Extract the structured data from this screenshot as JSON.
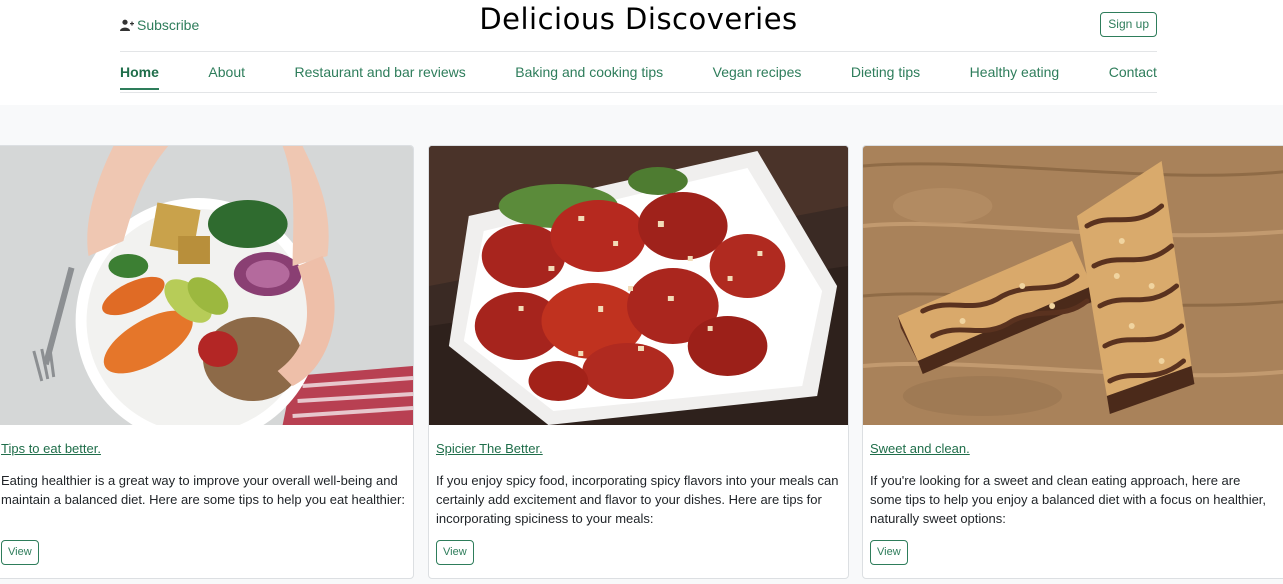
{
  "header": {
    "subscribe_label": "Subscribe",
    "brand": "Delicious Discoveries",
    "signup_label": "Sign up"
  },
  "nav": {
    "items": [
      {
        "label": "Home",
        "active": true
      },
      {
        "label": "About"
      },
      {
        "label": "Restaurant and bar reviews"
      },
      {
        "label": "Baking and cooking tips"
      },
      {
        "label": "Vegan recipes"
      },
      {
        "label": "Dieting tips"
      },
      {
        "label": "Healthy eating"
      },
      {
        "label": "Contact"
      }
    ]
  },
  "cards": [
    {
      "title": "Tips to eat better.",
      "description": "Eating healthier is a great way to improve your overall well-being and maintain a balanced diet. Here are some tips to help you eat healthier:",
      "button": "View",
      "image": "healthy-bowl-image"
    },
    {
      "title": "Spicier The Better.",
      "description": "If you enjoy spicy food, incorporating spicy flavors into your meals can certainly add excitement and flavor to your dishes. Here are tips for incorporating spiciness to your meals:",
      "button": "View",
      "image": "spicy-chicken-image"
    },
    {
      "title": "Sweet and clean.",
      "description": "If you're looking for a sweet and clean eating approach, here are some tips to help you enjoy a balanced diet with a focus on healthier, naturally sweet options:",
      "button": "View",
      "image": "granola-bars-image"
    }
  ],
  "colors": {
    "accent": "#2e7d5b",
    "page_bg": "#f8f9fa"
  }
}
